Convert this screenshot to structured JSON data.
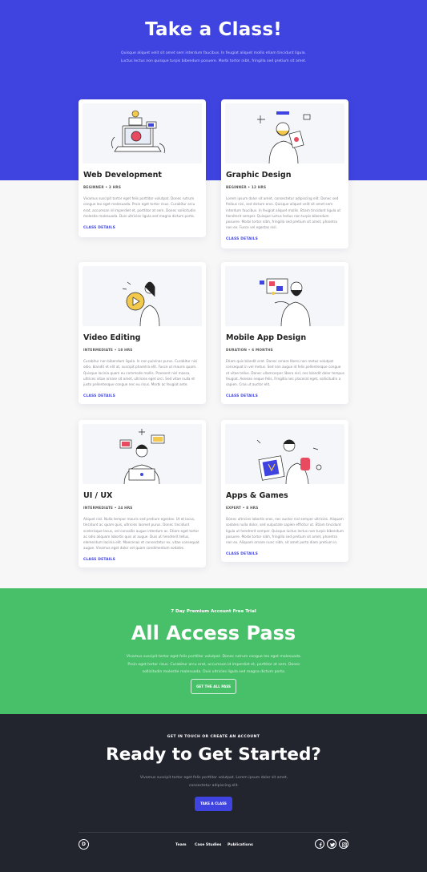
{
  "hero": {
    "title": "Take a Class!",
    "subtitle": "Quisque aliquet velit sit amet sem interdum faucibus. In feugiat aliquet mollis etiam tincidunt ligula. Luctus lectus non quisque turpis bibendum posuere. Morbi tortor nibh, fringilla sed pretium sit amet."
  },
  "classes": [
    {
      "title": "Web Development",
      "meta": "BEGINNER • 3 HRS",
      "description": "Vivamus suscipit tortor eget felis porttitor volutpat. Donec rutrum congue leo eget malesuada. Proin eget tortor risus. Curabitur arcu erat, accumsan id imperdiet et, porttitor at sem. Donec sollicitudin molestie malesuada. Duis ultricies ligula sed magna dictum porta.",
      "link": "CLASS DETAILS",
      "illustration": "web-development-illustration"
    },
    {
      "title": "Graphic Design",
      "meta": "BEGINNER • 12 HRS",
      "description": "Lorem ipsum dolor sit amet, consectetur adipiscing elit. Donec sed finibus nisi, sed dictum eros. Quisque aliquet velit sit amet sem interdum faucibus. In feugiat aliquet mollis. Etiam tincidunt ligula ut hendrerit semper. Quisque luctus lectus non turpis bibendum posuere. Morbi tortor nibh, fringilla sed pretium sit amet, pharetra non ex. Fusce vel egestas nisl.",
      "link": "CLASS DETAILS",
      "illustration": "graphic-design-illustration"
    },
    {
      "title": "Video Editing",
      "meta": "INTERMEDIATE • 18 HRS",
      "description": "Curabitur non bibendum ligula. In non pulvinar purus. Curabitur nisi odio, blandit et elit at, suscipit pharetra elit. Fusce ut mauris quam. Quisque lacinia quam eu commodo mollis. Praesent nisl massa, ultrices vitae ornare sit amet, ultricies eget orci. Sed vitae nulla et justo pellentesque congue nec eu risus. Morbi ac feugiat ante.",
      "link": "CLASS DETAILS",
      "illustration": "video-editing-illustration"
    },
    {
      "title": "Mobile App Design",
      "meta": "DURATION • 6 MONTHS",
      "description": "Etiam quis blandit erat. Donec ornare libero non metus volutpat consequat in vel metus. Sed non augue id felis pellentesque congue et vitae tellus. Donec ullamcorper libero nisl, nec blandit dolor tempus feugiat. Aenean neque felis, fringilla nec placerat eget, sollicitudin a sapien. Cras ut auctor elit.",
      "link": "CLASS DETAILS",
      "illustration": "mobile-app-design-illustration"
    },
    {
      "title": "UI / UX",
      "meta": "INTERMEDIATE • 24 HRS",
      "description": "Aliquet nisl. Nulla tempor mauris sed pretium egestas. Ut et lacus, tincidunt ac quam quis, ultricies laoreet purus. Donec tincidunt scelerisque lacus, vel convallis augue interdum ac. Etiam eget tortor ac odio aliquam lobortis quis ut augue. Duis ut hendrerit tellus, elementum lacinia elit. Maecenas et consectetur ex, vitae consequat augue. Vivamus eget dolor vel quam condimentum sodales.",
      "link": "CLASS DETAILS",
      "illustration": "ui-ux-illustration"
    },
    {
      "title": "Apps & Games",
      "meta": "EXPERT • 8 HRS",
      "description": "Donec ultricies lobortis eros, nec auctor nisl semper ultricies. Aliquam sodales nulla dolor, sed vulputate sapien efficitur ut. Etiam tincidunt ligula ut hendrerit semper. Quisque luctus lectus non turpis bibendum posuere. Morbi tortor nibh, fringilla sed pretium sit amet, pharetra non ex. Aliquam ornare nunc nibh, sit amet porta diam pretium in.",
      "link": "CLASS DETAILS",
      "illustration": "apps-games-illustration"
    }
  ],
  "pass": {
    "kicker": "7 Day Premium Account Free Trial",
    "title": "All Access Pass",
    "description": "Vivamus suscipit tortor eget felis porttitor volutpat. Donec rutrum congue leo eget malesuada. Proin eget tortor risus. Curabitur arcu erat, accumsan id imperdiet et, porttitor at sem. Donec sollicitudin molestie malesuada. Duis ultricies ligula sed magna dictum porta.",
    "button": "GET THE ALL PASS"
  },
  "cta": {
    "kicker": "GET IN TOUCH OR CREATE AN ACCOUNT",
    "title": "Ready to Get Started?",
    "description": "Vivamus suscipit tortor eget felis porttitor volutpat. Lorem ipsum dolor sit amet, consectetur adipiscing elit.",
    "button": "TAKE A CLASS"
  },
  "footer": {
    "logo": "D",
    "nav": [
      "Team",
      "Case Studies",
      "Publications"
    ],
    "social": [
      "facebook-icon",
      "twitter-icon",
      "instagram-icon"
    ]
  },
  "colors": {
    "primary": "#3f43e0",
    "green": "#48c069",
    "dark": "#22242e",
    "accent_yellow": "#f2c94c",
    "accent_red": "#e84a5f"
  }
}
